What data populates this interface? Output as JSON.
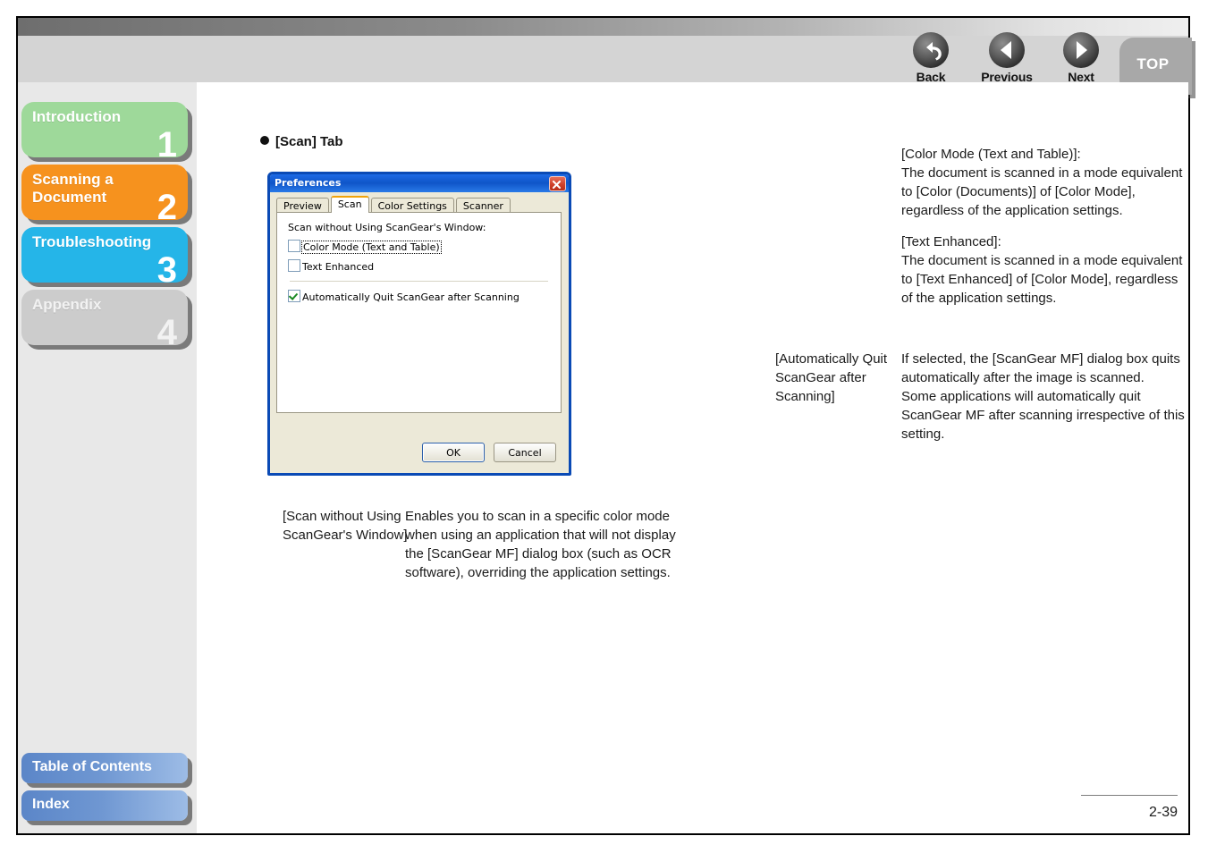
{
  "header": {
    "nav": [
      {
        "id": "back",
        "label": "Back",
        "icon": "back-arrow-icon"
      },
      {
        "id": "previous",
        "label": "Previous",
        "icon": "left-triangle-icon"
      },
      {
        "id": "next",
        "label": "Next",
        "icon": "right-triangle-icon"
      }
    ],
    "top_button": {
      "label": "TOP"
    }
  },
  "sidebar": {
    "chapters": [
      {
        "label": "Introduction",
        "number": "1",
        "color": "#9ed99a"
      },
      {
        "label": "Scanning a\nDocument",
        "number": "2",
        "color": "#f6921e"
      },
      {
        "label": "Troubleshooting",
        "number": "3",
        "color": "#25b5e8"
      },
      {
        "label": "Appendix",
        "number": "4",
        "color": "#cccccc"
      }
    ],
    "links": [
      {
        "label": "Table of Contents"
      },
      {
        "label": "Index"
      }
    ]
  },
  "content": {
    "heading": "[Scan] Tab",
    "dialog": {
      "title": "Preferences",
      "close_label": "✕",
      "tabs": [
        {
          "label": "Preview",
          "active": false
        },
        {
          "label": "Scan",
          "active": true
        },
        {
          "label": "Color Settings",
          "active": false
        },
        {
          "label": "Scanner",
          "active": false
        }
      ],
      "panel_label": "Scan without Using ScanGear's Window:",
      "checkboxes": [
        {
          "label": "Color Mode (Text and Table)",
          "checked": false,
          "focused": true
        },
        {
          "label": "Text Enhanced",
          "checked": false,
          "focused": false
        },
        {
          "label": "Automatically Quit ScanGear after Scanning",
          "checked": true,
          "focused": false
        }
      ],
      "buttons": [
        {
          "label": "OK",
          "default": true
        },
        {
          "label": "Cancel",
          "default": false
        }
      ]
    },
    "descriptions": [
      {
        "term": "[Scan without Using ScanGear's Window]",
        "paragraphs": [
          "Enables you to scan in a specific color mode when using an application that will not display the [ScanGear MF] dialog box (such as OCR software), overriding the application settings."
        ]
      },
      {
        "term": "",
        "paragraphs": [
          "[Color Mode (Text and Table)]:\nThe document is scanned in a mode equivalent to [Color (Documents)] of [Color Mode], regardless of the application settings.",
          "[Text Enhanced]:\nThe document is scanned in a mode equivalent to [Text Enhanced] of [Color Mode], regardless of the application settings."
        ]
      },
      {
        "term": "[Automatically Quit ScanGear after Scanning]",
        "paragraphs": [
          "If selected, the [ScanGear MF] dialog box quits automatically after the image is scanned.\nSome applications will automatically quit ScanGear MF after scanning irrespective of this setting."
        ]
      }
    ],
    "page_number": "2-39"
  }
}
